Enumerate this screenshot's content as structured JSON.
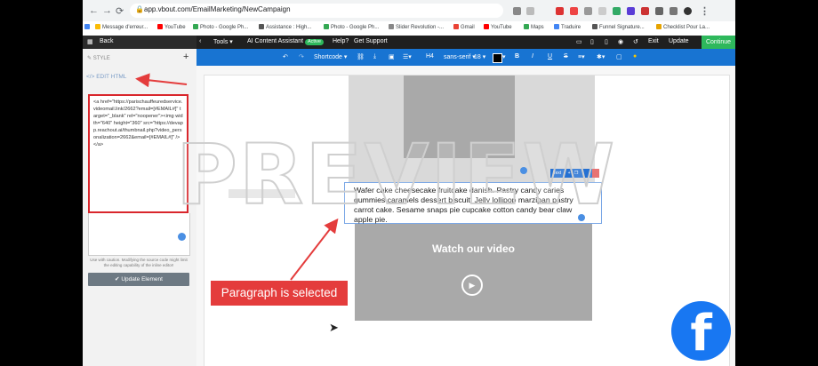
{
  "browser": {
    "url": "app.vbout.com/EmailMarketing/NewCampaign",
    "bookmarks": [
      "Message d'erreur...",
      "YouTube",
      "Photo - Google Ph...",
      "Assistance : High...",
      "Photo - Google Ph...",
      "Slider Revolution -...",
      "Gmail",
      "YouTube",
      "Maps",
      "Traduire",
      "Funnel Signature...",
      "Checklist Pour La..."
    ]
  },
  "left_panel": {
    "back_label": "Back",
    "style_label": "STYLE",
    "edit_html_label": "EDIT HTML",
    "code": "<a href=\"https://parischauffeuredservice.videomail.link/2662?email=[#EMAIL#]\" target=\"_blank\" rel=\"noopener\"><img width=\"640\" height=\"360\" src=\"https://devapp.reachout.ai/thumbnail.php?video_personalization=2662&email=[#EMAIL#]\" /> </a>",
    "caution": "Use with caution. Modifying the source code might limit the editing capability of the inline editor!",
    "update_label": "Update Element"
  },
  "topbar": {
    "tools": "Tools",
    "ai_assistant": "AI Content Assistant",
    "ai_badge": "Active",
    "help": "Help?",
    "support": "Get Support",
    "exit": "Exit",
    "update": "Update",
    "continue": "Continue"
  },
  "formatbar": {
    "shortcode": "Shortcode",
    "heading": "H4",
    "font": "sans-serif",
    "size": "18",
    "bold": "B",
    "italic": "I",
    "underline": "U",
    "strike": "S"
  },
  "canvas": {
    "paragraph": "Wafer cake cheesecake fruitcake danish. Pastry candy caries gummies caramels dessert biscuit. Jelly lollipop marzipan pastry carrot cake. Sesame snaps pie cupcake cotton candy bear claw apple pie.",
    "text_toolbar_label": "Text",
    "video_title": "Watch our video",
    "watermark": "PREVIEW"
  },
  "annotation": {
    "callout": "Paragraph is selected"
  },
  "colors": {
    "accent_blue": "#1874d2",
    "annotation_red": "#e43c3c",
    "facebook_blue": "#1877f2",
    "success_green": "#2eb85c"
  }
}
